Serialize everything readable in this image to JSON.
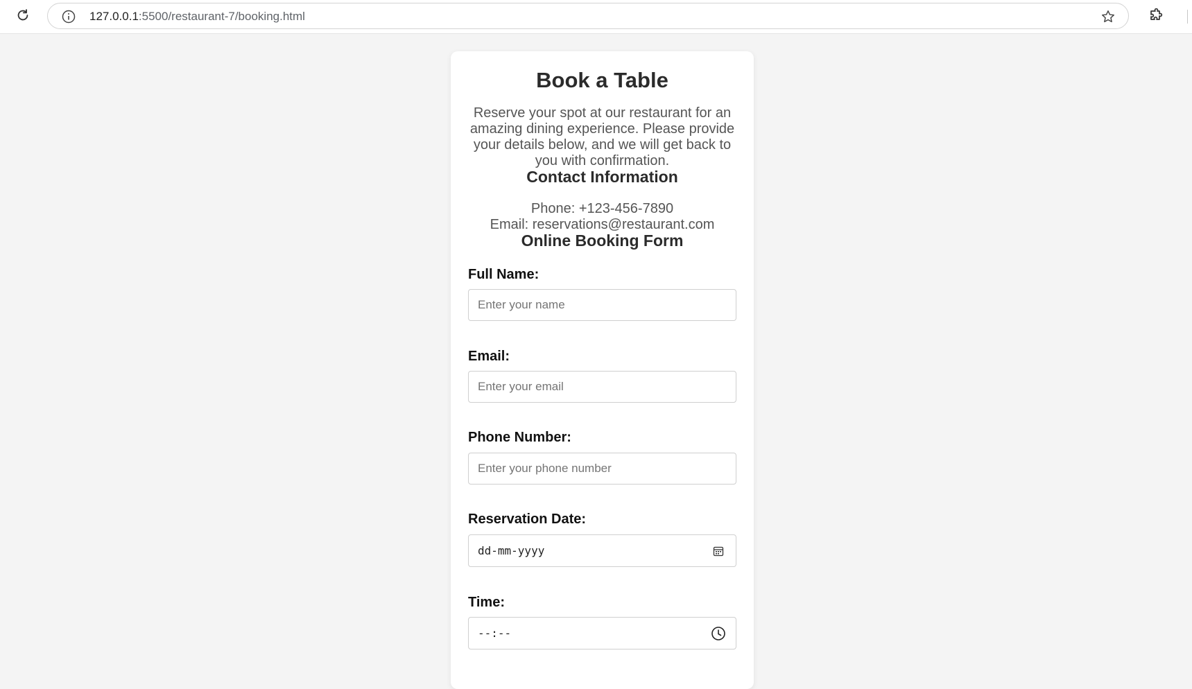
{
  "browser": {
    "url_host": "127.0.0.1",
    "url_rest": ":5500/restaurant-7/booking.html"
  },
  "page": {
    "title": "Book a Table",
    "intro": "Reserve your spot at our restaurant for an amazing dining experience. Please provide your details below, and we will get back to you with confirmation.",
    "contact": {
      "heading": "Contact Information",
      "phone": "Phone: +123-456-7890",
      "email": "Email: reservations@restaurant.com"
    },
    "form": {
      "heading": "Online Booking Form",
      "full_name": {
        "label": "Full Name:",
        "placeholder": "Enter your name",
        "value": ""
      },
      "email": {
        "label": "Email:",
        "placeholder": "Enter your email",
        "value": ""
      },
      "phone": {
        "label": "Phone Number:",
        "placeholder": "Enter your phone number",
        "value": ""
      },
      "date": {
        "label": "Reservation Date:",
        "placeholder": "dd-mm-yyyy"
      },
      "time": {
        "label": "Time:",
        "placeholder": "--:--"
      }
    }
  },
  "icons": {
    "reload": "reload-icon",
    "info": "info-icon",
    "star": "star-icon",
    "extensions": "puzzle-icon",
    "calendar": "calendar-icon",
    "clock": "clock-icon"
  }
}
